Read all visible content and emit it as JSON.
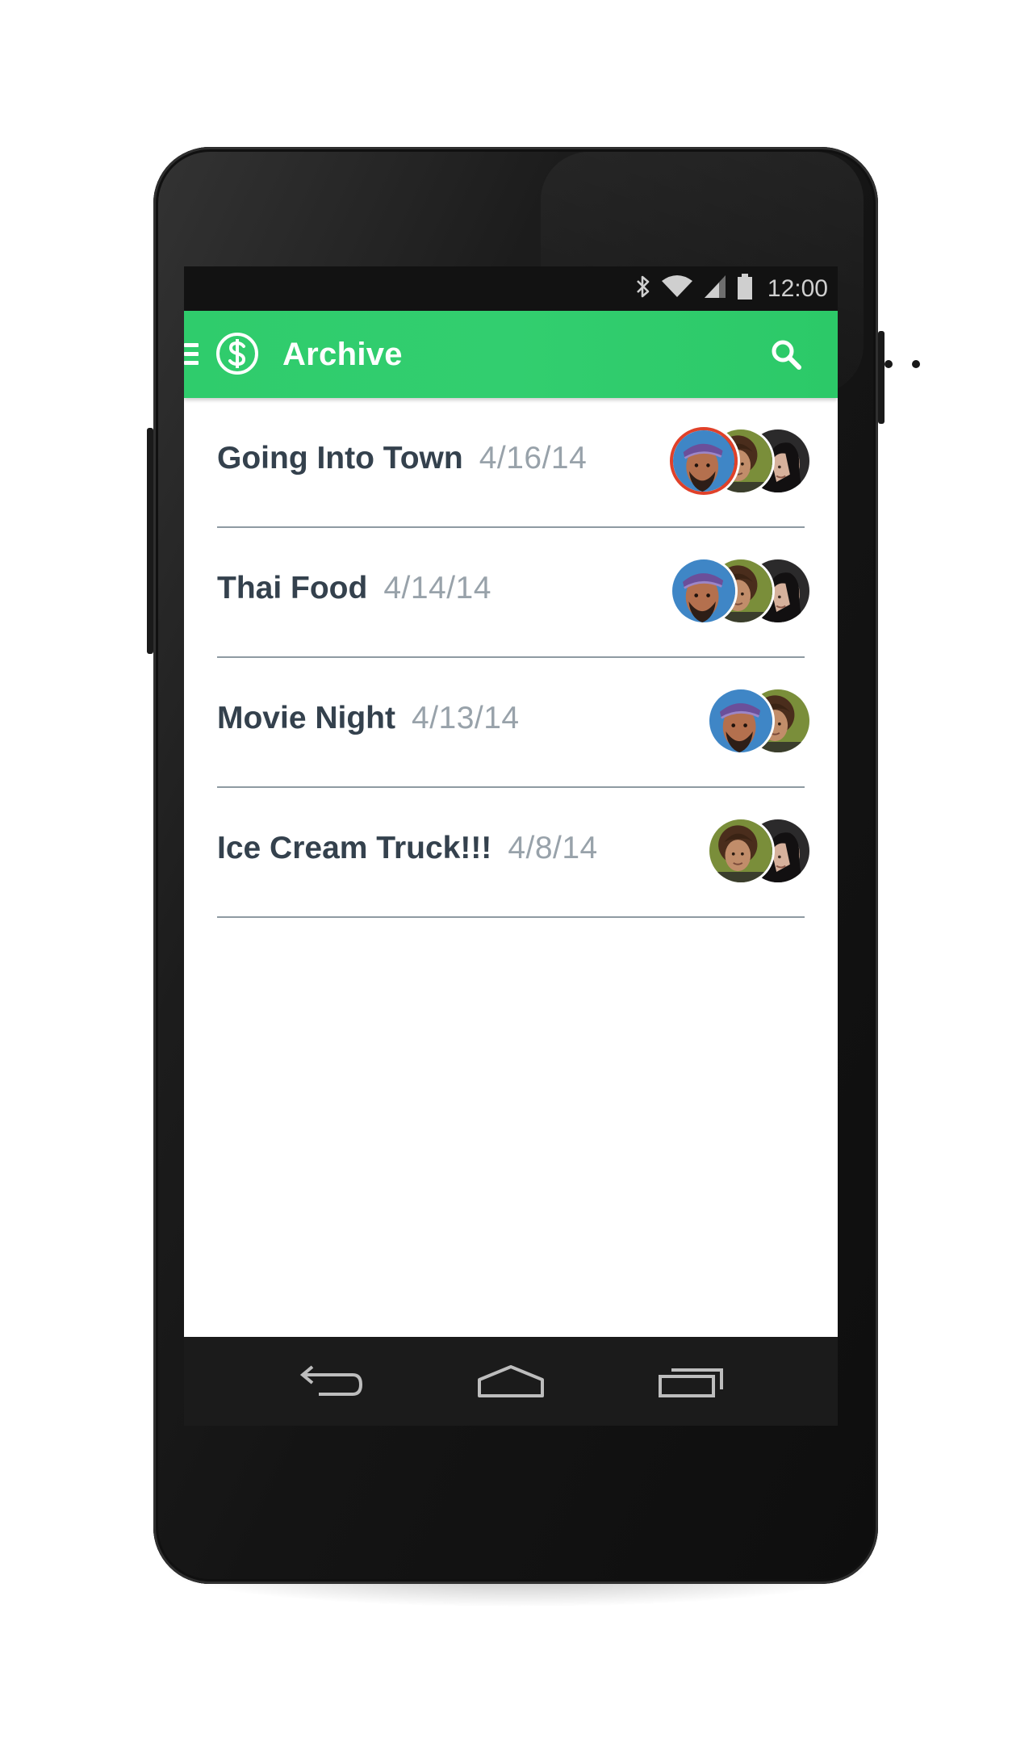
{
  "status_bar": {
    "time": "12:00",
    "icons": [
      "bluetooth-icon",
      "wifi-icon",
      "signal-icon",
      "battery-icon"
    ]
  },
  "app_bar": {
    "title": "Archive",
    "icons": [
      "menu-icon",
      "dollar-logo-icon",
      "search-icon"
    ],
    "color": "#2fcc6c"
  },
  "list": {
    "items": [
      {
        "title": "Going Into Town",
        "date": "4/16/14",
        "avatars": [
          "person-bandana",
          "person-curly",
          "person-woman"
        ],
        "selected_avatar": "person-bandana"
      },
      {
        "title": "Thai Food",
        "date": "4/14/14",
        "avatars": [
          "person-bandana",
          "person-curly",
          "person-woman"
        ]
      },
      {
        "title": "Movie Night",
        "date": "4/13/14",
        "avatars": [
          "person-bandana",
          "person-curly"
        ]
      },
      {
        "title": "Ice Cream Truck!!!",
        "date": "4/8/14",
        "avatars": [
          "person-curly",
          "person-woman"
        ]
      }
    ]
  },
  "nav_bar": {
    "icons": [
      "back-icon",
      "home-icon",
      "recent-apps-icon"
    ]
  },
  "colors": {
    "accent_green": "#2fcc6c",
    "title_text": "#34414d",
    "date_text": "#98a2aa",
    "selected_ring": "#e0412a"
  }
}
